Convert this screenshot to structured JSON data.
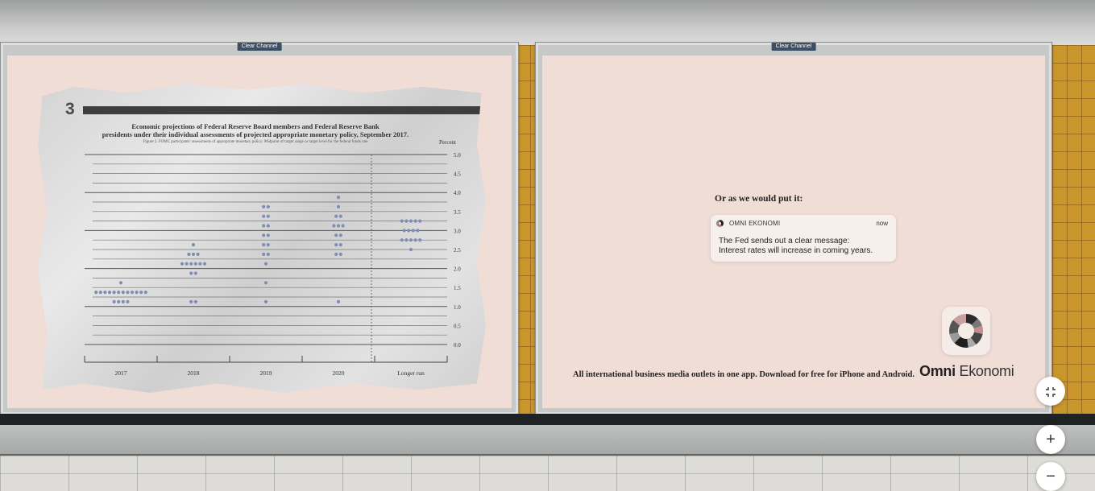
{
  "billboard_brand": "Clear Channel",
  "figure": {
    "number": "3",
    "title_line1": "Economic projections of Federal Reserve Board members and Federal Reserve Bank",
    "title_line2": "presidents under their individual assessments of projected appropriate monetary policy, September 2017.",
    "subtitle": "Figure 2. FOMC participants' assessments of appropriate monetary policy: Midpoint of target range or target level for the federal funds rate",
    "unit": "Percent"
  },
  "chart_data": {
    "type": "scatter",
    "title": "Economic projections of Federal Reserve Board members and Federal Reserve Bank presidents under their individual assessments of projected appropriate monetary policy, September 2017.",
    "ylabel": "Percent",
    "ylim": [
      0,
      5
    ],
    "categories": [
      "2017",
      "2018",
      "2019",
      "2020",
      "Longer run"
    ],
    "yticks": [
      "5.0",
      "4.5",
      "4.0",
      "3.5",
      "3.0",
      "2.5",
      "2.0",
      "1.5",
      "1.0",
      "0.5",
      "0.0"
    ],
    "series": [
      {
        "values": [
          [
            1.125,
            4
          ],
          [
            1.375,
            12
          ],
          [
            1.625,
            1
          ]
        ]
      },
      {
        "values": [
          [
            1.125,
            2
          ],
          [
            1.875,
            2
          ],
          [
            2.125,
            6
          ],
          [
            2.375,
            3
          ],
          [
            2.625,
            1
          ]
        ]
      },
      {
        "values": [
          [
            1.125,
            1
          ],
          [
            1.625,
            1
          ],
          [
            2.125,
            1
          ],
          [
            2.375,
            2
          ],
          [
            2.625,
            2
          ],
          [
            2.875,
            2
          ],
          [
            3.125,
            2
          ],
          [
            3.375,
            2
          ],
          [
            3.625,
            2
          ]
        ]
      },
      {
        "values": [
          [
            1.125,
            1
          ],
          [
            2.375,
            2
          ],
          [
            2.625,
            2
          ],
          [
            2.875,
            2
          ],
          [
            3.125,
            3
          ],
          [
            3.375,
            2
          ],
          [
            3.625,
            1
          ],
          [
            3.875,
            1
          ]
        ]
      },
      {
        "values": [
          [
            2.5,
            1
          ],
          [
            2.75,
            5
          ],
          [
            3.0,
            4
          ],
          [
            3.25,
            5
          ]
        ]
      }
    ],
    "grid": true
  },
  "ad": {
    "lead": "Or as we would put it:",
    "notification": {
      "app": "OMNI EKONOMI",
      "time": "now",
      "line1": "The Fed sends out a clear message:",
      "line2": "Interest rates will increase in coming years."
    },
    "tagline": "All international business media outlets in one app. Download for free for iPhone and Android.",
    "logo_part1": "Omni",
    "logo_part2": "Ekonomi"
  },
  "controls": {
    "fullscreen_icon": "exit-fullscreen-icon",
    "zoom_in_label": "+",
    "zoom_out_label": "−"
  }
}
